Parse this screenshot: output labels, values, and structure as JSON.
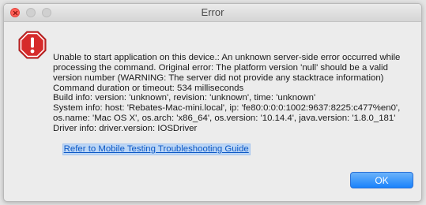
{
  "window": {
    "title": "Error"
  },
  "alert": {
    "icon": "error-stop-icon",
    "message": "Unable to start application on this device.: An unknown server-side error occurred while processing the command. Original error: The platform version 'null' should be a valid version number (WARNING: The server did not provide any stacktrace information)\nCommand duration or timeout: 534 milliseconds\nBuild info: version: 'unknown', revision: 'unknown', time: 'unknown'\nSystem info: host: 'Rebates-Mac-mini.local', ip: 'fe80:0:0:0:1002:9637:8225:c477%en0', os.name: 'Mac OS X', os.arch: 'x86_64', os.version: '10.14.4', java.version: '1.8.0_181'\nDriver info: driver.version: IOSDriver",
    "link_text": "Refer to Mobile Testing Troubleshooting Guide"
  },
  "buttons": {
    "ok_label": "OK"
  },
  "colors": {
    "close": "#ff5f57",
    "accent": "#1a82fb",
    "error_red": "#d62b2b"
  }
}
